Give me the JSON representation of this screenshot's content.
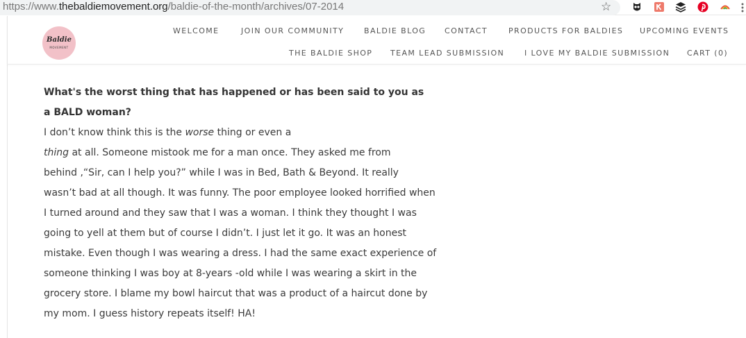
{
  "browser": {
    "url_scheme": "https://www.",
    "url_host": "thebaldiemovement.org",
    "url_path": "/baldie-of-the-month/archives/07-2014",
    "bookmark_icon": "star-icon",
    "extensions": [
      "owl-icon",
      "k-icon",
      "layers-icon",
      "pinterest-icon",
      "rainbow-icon"
    ]
  },
  "site": {
    "logo_text": "Baldie",
    "logo_sub": "MOVEMENT",
    "logo_color": "#f2c1c8",
    "nav_row1": [
      "WELCOME",
      "JOIN OUR COMMUNITY",
      "BALDIE BLOG",
      "CONTACT",
      "PRODUCTS FOR BALDIES",
      "UPCOMING EVENTS"
    ],
    "nav_row2": [
      "THE BALDIE SHOP",
      "TEAM LEAD SUBMISSION",
      "I LOVE MY BALDIE SUBMISSION",
      "CART (0)"
    ]
  },
  "article": {
    "question_line1": "What's the worst thing that has happened or has been said to you as",
    "question_line2": "a BALD woman?",
    "line1_a": "I don’t know think this is the ",
    "line1_em": "worse",
    "line1_b": " thing or even a",
    "line2_em": "thing",
    "line2_b": " at all. Someone mistook me for a man once. They asked me from",
    "lines": [
      "behind ,“Sir, can I help you?” while I was in Bed, Bath & Beyond. It really",
      "wasn’t bad at all though. It was funny. The poor employee looked horrified when",
      "I turned around and they saw that I was a woman. I think they thought I was",
      "going to yell at them but of course I didn’t. I just let it go. It was an honest",
      "mistake. Even though I was wearing a dress. I had the same exact experience of",
      "someone thinking I was boy at 8-years -old while I was wearing a skirt in the",
      "grocery store. I blame my bowl haircut that was a product of a haircut done by",
      "my mom. I guess history repeats itself! HA!"
    ]
  }
}
